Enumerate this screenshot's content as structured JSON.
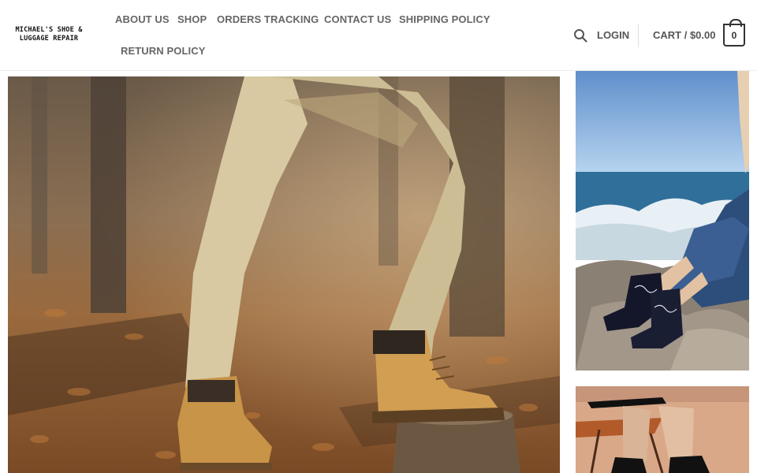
{
  "brand": {
    "line1": "MICHAEL'S SHOE &",
    "line2": "LUGGAGE REPAIR"
  },
  "nav": {
    "items": [
      {
        "label": "ABOUT US"
      },
      {
        "label": "SHOP"
      },
      {
        "label": "ORDERS TRACKING"
      },
      {
        "label": "CONTACT US"
      },
      {
        "label": "SHIPPING POLICY"
      },
      {
        "label": "RETURN POLICY"
      }
    ]
  },
  "header_tools": {
    "search_icon": "search-icon",
    "login_label": "LOGIN",
    "cart_label": "CART / $0.00",
    "cart_count": "0"
  },
  "images": {
    "hero": "boots-on-tree-stump",
    "side_top": "western-boots-by-sea",
    "side_bottom": "black-boots-on-chair"
  }
}
